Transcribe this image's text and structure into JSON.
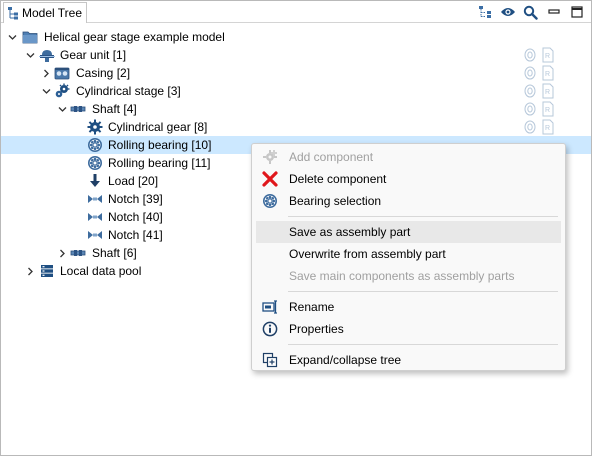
{
  "tab": {
    "label": "Model Tree"
  },
  "toolbar": {
    "icons": [
      "tree-layout-icon",
      "eye-icon",
      "search-icon",
      "minimize-icon",
      "maximize-icon"
    ]
  },
  "tree": {
    "root": "Helical gear stage example model",
    "gear_unit": "Gear unit [1]",
    "casing": "Casing [2]",
    "cyl_stage": "Cylindrical stage [3]",
    "shaft4": "Shaft [4]",
    "cyl_gear": "Cylindrical gear [8]",
    "rb10": "Rolling bearing [10]",
    "rb11": "Rolling bearing [11]",
    "load": "Load [20]",
    "notch39": "Notch [39]",
    "notch40": "Notch [40]",
    "notch41": "Notch [41]",
    "shaft6": "Shaft [6]",
    "pool": "Local data pool"
  },
  "menu": {
    "add_component": "Add component",
    "delete_component": "Delete component",
    "bearing_selection": "Bearing selection",
    "save_assembly": "Save as assembly part",
    "overwrite_assembly": "Overwrite from assembly part",
    "save_main": "Save main components as assembly parts",
    "rename": "Rename",
    "properties": "Properties",
    "expand_collapse": "Expand/collapse tree"
  },
  "colors": {
    "selection": "#cce8ff",
    "menu_bg": "#f9f9f9",
    "delete_red": "#e0161b",
    "icon_blue": "#2f5f8f"
  }
}
